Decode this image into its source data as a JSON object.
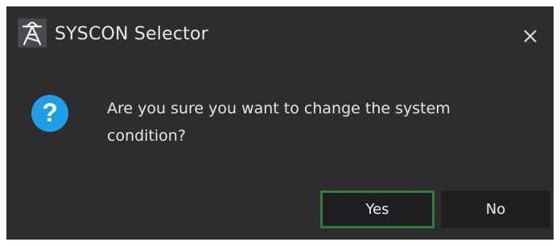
{
  "window": {
    "title": "SYSCON Selector",
    "close_icon": "close-icon",
    "app_icon": "tower-icon"
  },
  "dialog": {
    "icon": "question-icon",
    "message": "Are you sure you want to change the system condition?"
  },
  "buttons": {
    "yes_label": "Yes",
    "no_label": "No"
  },
  "colors": {
    "background": "#2d2d30",
    "button_background": "#1f1f22",
    "focus_border": "#2e7d3a",
    "question_icon": "#1e9fe6",
    "text": "#e6e6e6"
  }
}
